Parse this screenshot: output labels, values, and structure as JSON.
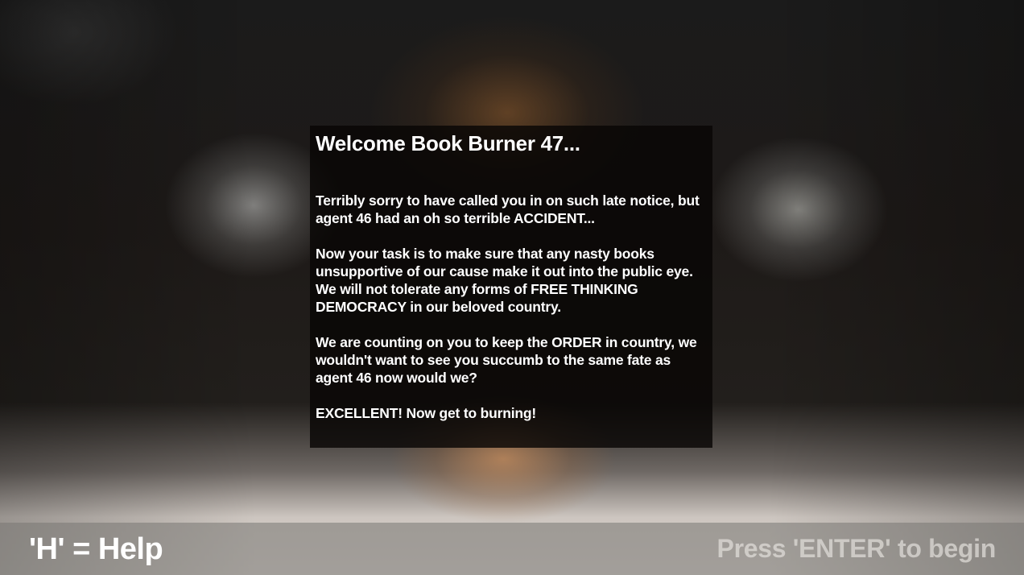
{
  "dialog": {
    "title": "Welcome Book Burner 47...",
    "paragraphs": [
      "Terribly sorry to have called you in on such late notice, but agent 46 had an oh so terrible ACCIDENT...",
      "Now your task is to make sure that any nasty books unsupportive of our cause make it out into the public eye. We will not tolerate any forms of FREE THINKING DEMOCRACY in our beloved country.",
      "We are counting on you to keep the ORDER in country, we wouldn't want to see you succumb to the same fate as agent 46 now would we?",
      "EXCELLENT! Now get to burning!"
    ]
  },
  "bottom_bar": {
    "help_hint": "'H' = Help",
    "start_hint": "Press 'ENTER' to begin"
  }
}
